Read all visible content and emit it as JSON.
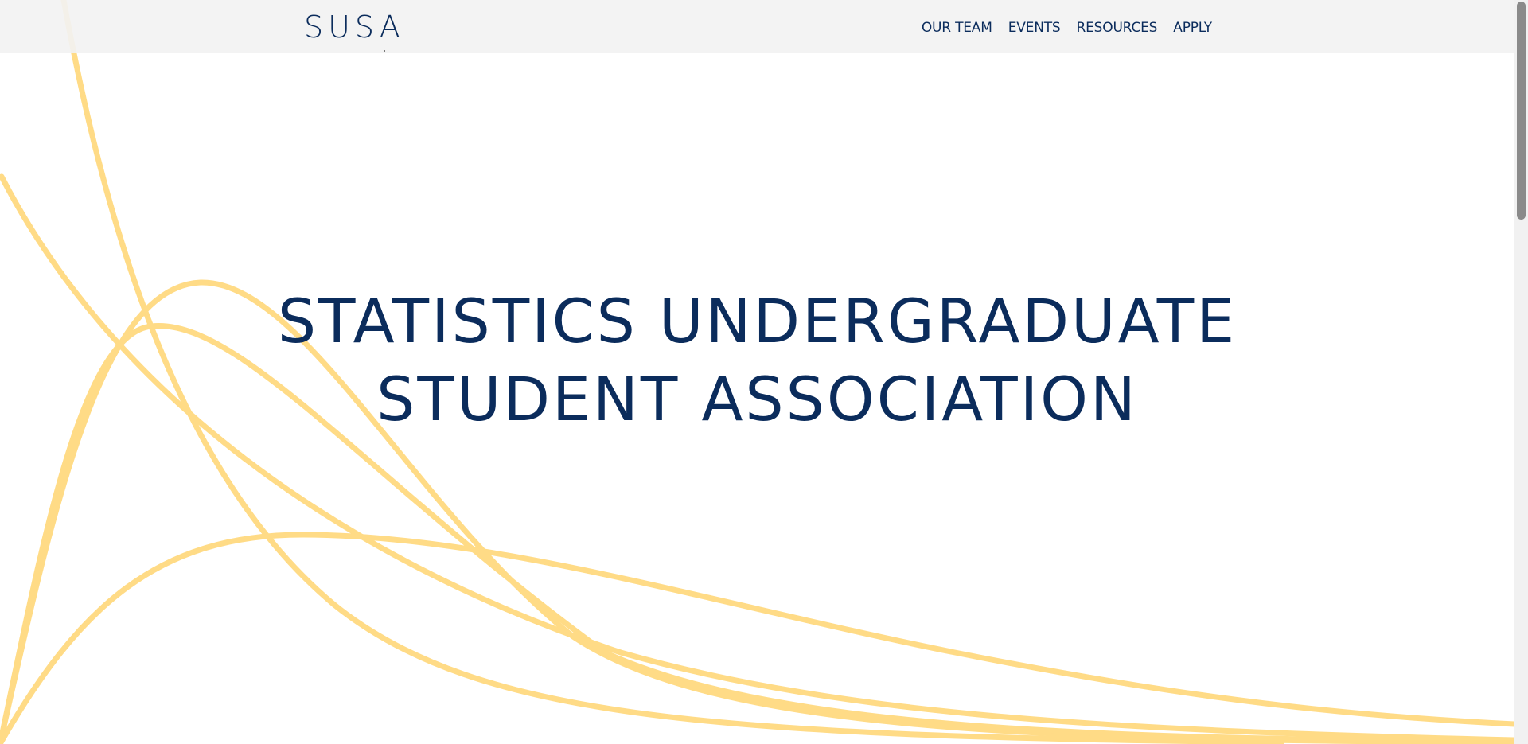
{
  "brand": {
    "name": "SUSA"
  },
  "nav": {
    "items": [
      {
        "label": "OUR TEAM"
      },
      {
        "label": "EVENTS"
      },
      {
        "label": "RESOURCES"
      },
      {
        "label": "APPLY"
      }
    ]
  },
  "hero": {
    "line1": "STATISTICS UNDERGRADUATE",
    "line2": "STUDENT ASSOCIATION"
  },
  "colors": {
    "primary": "#0b2c5c",
    "curve": "#ffdb86",
    "navbar_bg": "#f2f2f2",
    "background": "#ffffff"
  },
  "icons": {
    "background_decoration": "distribution-curves-graphic"
  }
}
